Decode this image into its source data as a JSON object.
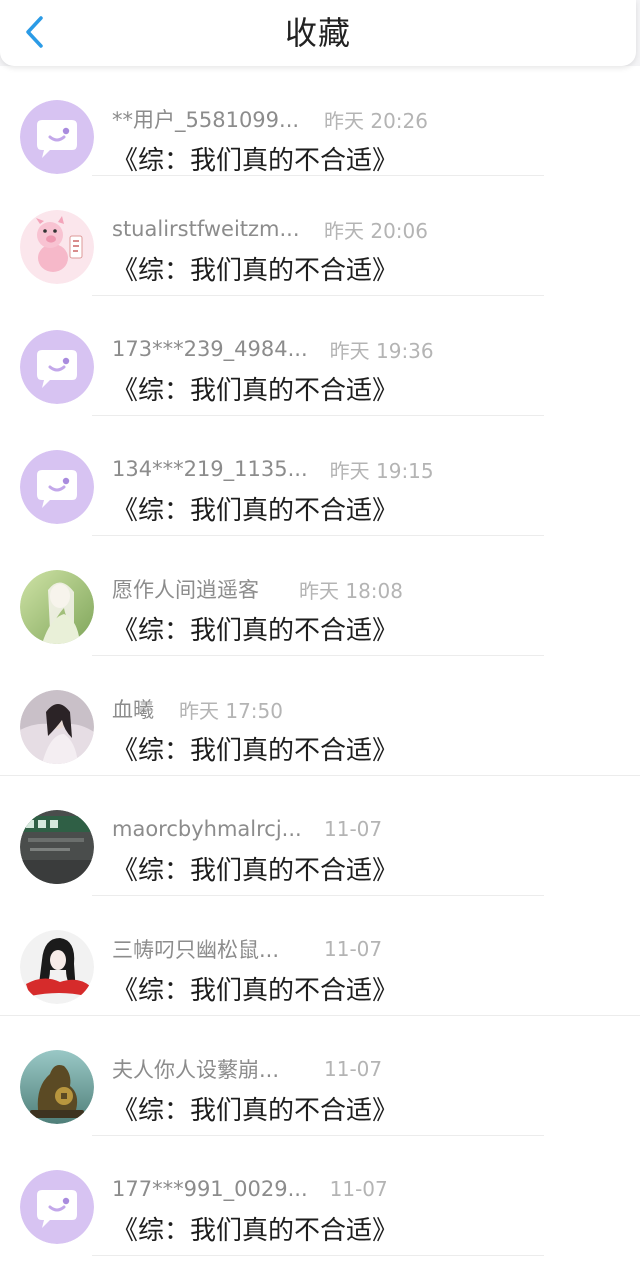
{
  "header": {
    "title": "收藏"
  },
  "items": [
    {
      "name": "**用户_5581099...",
      "time": "昨天 20:26",
      "content": "《综：我们真的不合适》",
      "avatar": "default-chat-avatar",
      "name_width": 190
    },
    {
      "name": "stualirstfweitzm...",
      "time": "昨天 20:06",
      "content": "《综：我们真的不合适》",
      "avatar": "pig-avatar",
      "name_width": 190
    },
    {
      "name": "173***239_4984...",
      "time": "昨天 19:36",
      "content": "《综：我们真的不合适》",
      "avatar": "default-chat-avatar",
      "name_width": 190
    },
    {
      "name": "134***219_1135...",
      "time": "昨天 19:15",
      "content": "《综：我们真的不合适》",
      "avatar": "default-chat-avatar",
      "name_width": 190
    },
    {
      "name": "愿作人间逍遥客",
      "time": "昨天 18:08",
      "content": "《综：我们真的不合适》",
      "avatar": "green-portrait-avatar",
      "name_width": 165
    },
    {
      "name": "血曦",
      "time": "昨天 17:50",
      "content": "《综：我们真的不合适》",
      "avatar": "dark-portrait-avatar",
      "name_width": 45
    },
    {
      "name": "maorcbyhmalrcj...",
      "time": "11-07",
      "content": "《综：我们真的不合适》",
      "avatar": "sign-photo-avatar",
      "name_width": 190
    },
    {
      "name": "三帱叼只幽松鼠...",
      "time": "11-07",
      "content": "《综：我们真的不合适》",
      "avatar": "drawn-girl-avatar",
      "name_width": 190
    },
    {
      "name": "夫人你人设蘩崩...",
      "time": "11-07",
      "content": "《综：我们真的不合适》",
      "avatar": "bronze-statue-avatar",
      "name_width": 190
    },
    {
      "name": "177***991_0029...",
      "time": "11-07",
      "content": "《综：我们真的不合适》",
      "avatar": "default-chat-avatar",
      "name_width": 190
    }
  ],
  "colors": {
    "accent": "#2b9be6",
    "avatar_purple": "#d7c3f2"
  }
}
